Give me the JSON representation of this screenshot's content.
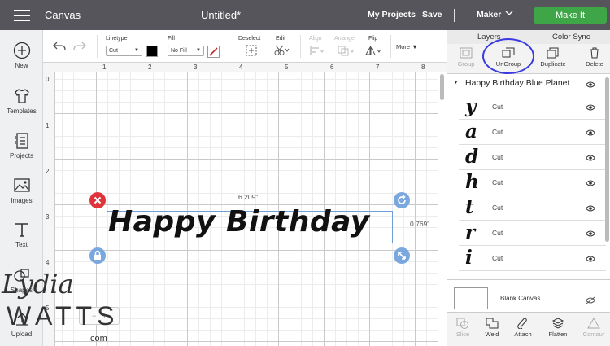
{
  "topbar": {
    "app_name": "Canvas",
    "doc_title": "Untitled*",
    "my_projects": "My Projects",
    "save": "Save",
    "machine": "Maker",
    "make_it": "Make It"
  },
  "sidebar": {
    "items": [
      {
        "label": "New",
        "icon": "plus-circle-icon"
      },
      {
        "label": "Templates",
        "icon": "shirt-icon"
      },
      {
        "label": "Projects",
        "icon": "projects-icon"
      },
      {
        "label": "Images",
        "icon": "image-icon"
      },
      {
        "label": "Text",
        "icon": "text-icon"
      },
      {
        "label": "Shapes",
        "icon": "shapes-icon"
      },
      {
        "label": "Upload",
        "icon": "upload-icon"
      }
    ]
  },
  "toolbar": {
    "linetype_label": "Linetype",
    "linetype_value": "Cut",
    "fill_label": "Fill",
    "fill_value": "No Fill",
    "deselect": "Deselect",
    "edit": "Edit",
    "align": "Align",
    "arrange": "Arrange",
    "flip": "Flip",
    "more": "More",
    "swatch_color": "#000000",
    "pen_color": "#c0282d"
  },
  "canvas": {
    "ruler_top": [
      "1",
      "2",
      "3",
      "4",
      "5",
      "6",
      "7",
      "8"
    ],
    "ruler_left": [
      "0",
      "1",
      "2",
      "3",
      "4",
      "5"
    ],
    "ruler_origin": "0",
    "design_text": "Happy Birthday",
    "width_label": "6.209\"",
    "height_label": "0.769\""
  },
  "right_panel": {
    "tabs": [
      "Layers",
      "Color Sync"
    ],
    "actions": [
      "Group",
      "UnGroup",
      "Duplicate",
      "Delete"
    ],
    "group_name": "Happy Birthday Blue Planet",
    "layers": [
      {
        "glyph": "y",
        "operation": "Cut"
      },
      {
        "glyph": "a",
        "operation": "Cut"
      },
      {
        "glyph": "d",
        "operation": "Cut"
      },
      {
        "glyph": "h",
        "operation": "Cut"
      },
      {
        "glyph": "t",
        "operation": "Cut"
      },
      {
        "glyph": "r",
        "operation": "Cut"
      },
      {
        "glyph": "i",
        "operation": "Cut"
      }
    ],
    "blank_canvas": "Blank Canvas",
    "bottom_actions": [
      "Slice",
      "Weld",
      "Attach",
      "Flatten",
      "Contour"
    ]
  },
  "watermark": {
    "line1": "Lydia",
    "line2": "WATTS",
    "line3": ".com"
  },
  "colors": {
    "topbar": "#55555b",
    "make_it": "#3fa648",
    "selection": "#6d9fd8",
    "delete_handle": "#e0343d",
    "highlight_circle": "#3a3ae0"
  }
}
